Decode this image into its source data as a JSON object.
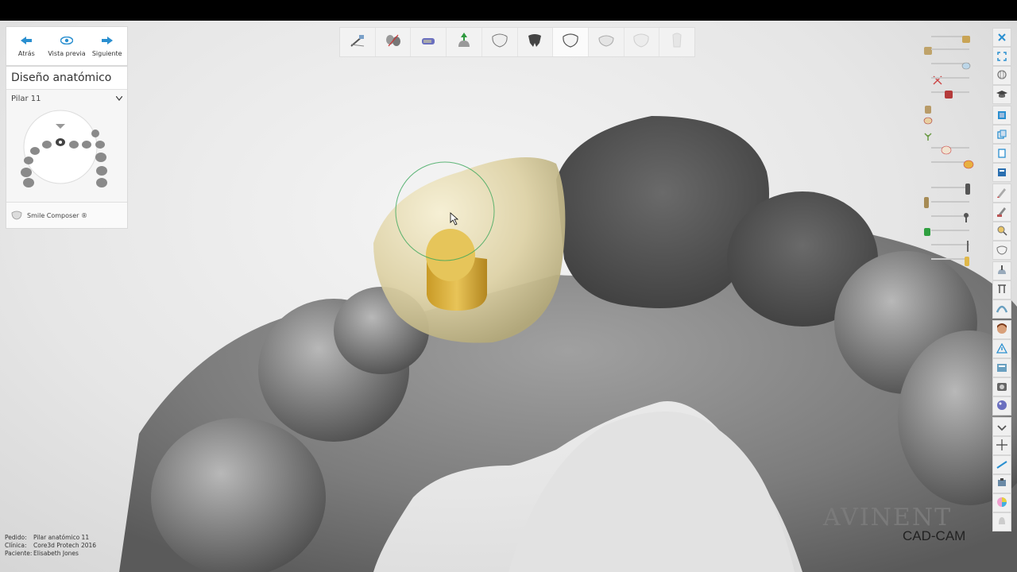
{
  "nav": {
    "back_label": "Atrás",
    "preview_label": "Vista previa",
    "next_label": "Siguiente"
  },
  "panel": {
    "title": "Diseño anatómico",
    "selector_value": "Pilar 11",
    "smile_composer_label": "Smile Composer ®"
  },
  "toolbar": {
    "steps": [
      "scissors-tool-icon",
      "divide-tool-icon",
      "paint-tool-icon",
      "insertion-axis-icon",
      "tooth-outline-icon",
      "tooth-dark-icon",
      "tooth-active-icon",
      "tooth-light-icon",
      "tooth-lighter-icon",
      "tooth-ghost-icon"
    ]
  },
  "right_toolbar": {
    "icons": [
      "close-icon",
      "fullscreen-icon",
      "rotate-icon",
      "graduation-cap-icon",
      "box-icon",
      "copy-icon",
      "duplicate-icon",
      "document-icon",
      "pen-icon",
      "sculpt-icon",
      "search-tooth-icon",
      "tooth-icon",
      "attachment-icon",
      "matrix-icon",
      "arch-icon",
      "face-icon",
      "warning-icon",
      "info-card-icon",
      "photo-icon",
      "palette-icon",
      "chevron-down-icon",
      "cross-icon",
      "tool-icon",
      "abutment-icon",
      "color-wheel-icon",
      "bell-icon"
    ]
  },
  "info": {
    "pedido_label": "Pedido:",
    "pedido_value": "Pilar anatómico 11",
    "clinica_label": "Clínica:",
    "clinica_value": "Core3d Protech 2016",
    "paciente_label": "Paciente:",
    "paciente_value": "Elisabeth Jones"
  },
  "brand": {
    "logo": "AVINENT",
    "sub": "CAD-CAM"
  },
  "colors": {
    "background": "#e6e6e6",
    "crown": "#e9dfb8",
    "abutment": "#e2bc4c",
    "model": "#8c8c8c",
    "accent_blue": "#2a8fd0"
  }
}
